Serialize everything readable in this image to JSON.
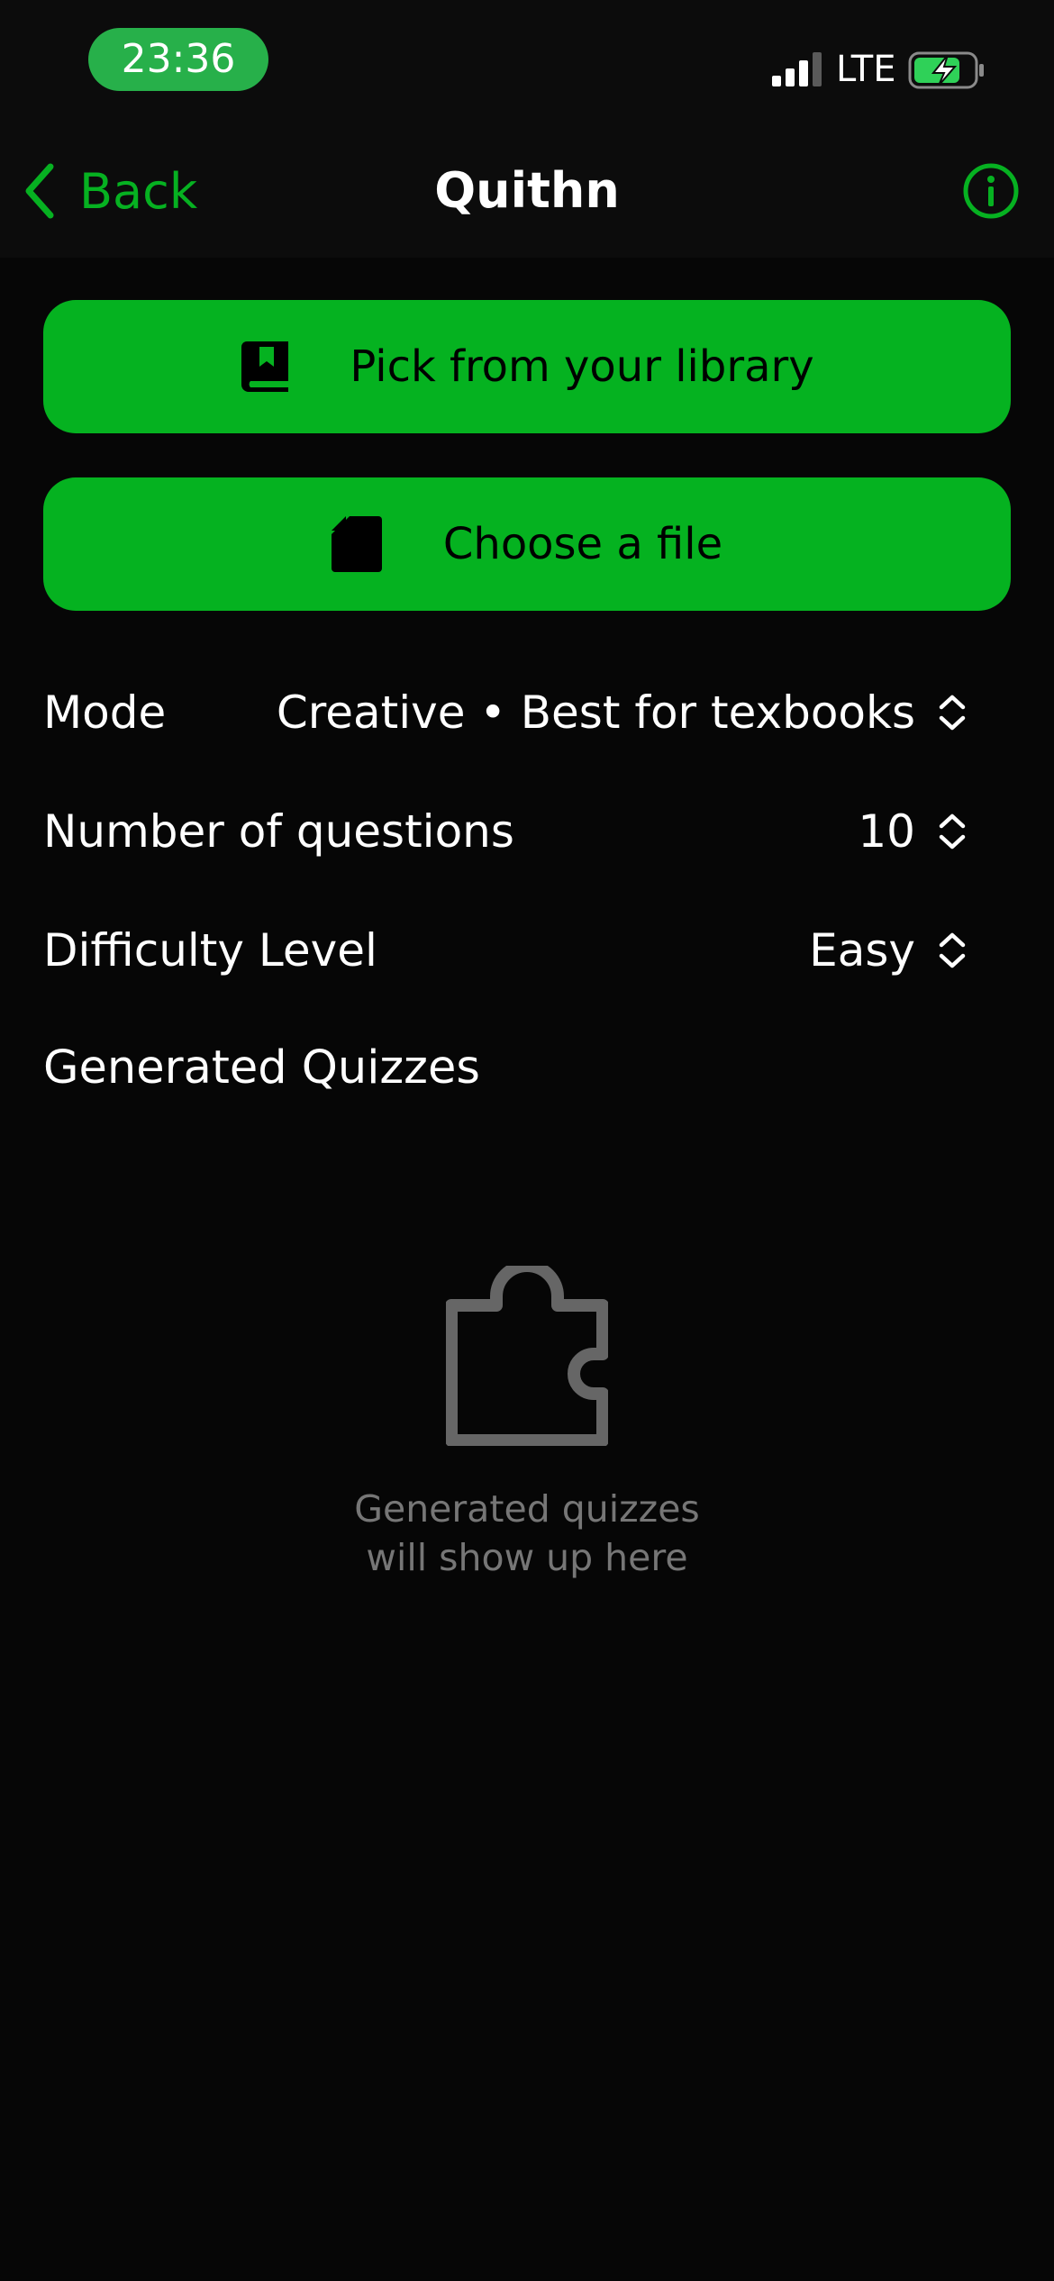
{
  "status_bar": {
    "time": "23:36",
    "network": "LTE",
    "accent_color": "#27b04a"
  },
  "nav": {
    "back_label": "Back",
    "title": "Quithn",
    "accent_color": "#06b121"
  },
  "actions": {
    "library_label": "Pick from your library",
    "file_label": "Choose a file",
    "button_color": "#05b220"
  },
  "settings": {
    "mode": {
      "label": "Mode",
      "value": "Creative • Best for texbooks"
    },
    "question_count": {
      "label": "Number of questions",
      "value": "10"
    },
    "difficulty": {
      "label": "Difficulty Level",
      "value": "Easy"
    }
  },
  "quizzes": {
    "section_title": "Generated Quizzes",
    "empty_line1": "Generated quizzes",
    "empty_line2": "will show up here",
    "empty_icon": "puzzle-icon"
  }
}
